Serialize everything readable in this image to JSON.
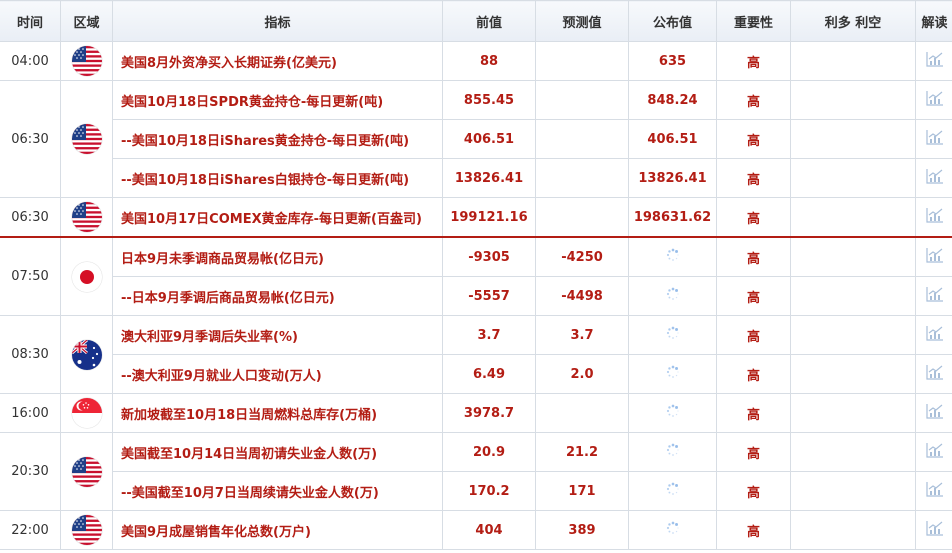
{
  "header": {
    "time": "时间",
    "region": "区域",
    "indicator": "指标",
    "previous": "前值",
    "forecast": "预测值",
    "actual": "公布值",
    "importance": "重要性",
    "impact": "利多 利空",
    "analysis": "解读"
  },
  "groups": [
    {
      "time": "04:00",
      "flag": "us-flag-icon"
    },
    {
      "time": "06:30",
      "flag": "us-flag-icon"
    },
    {
      "time": "06:30",
      "flag": "us-flag-icon"
    },
    {
      "time": "07:50",
      "flag": "japan-flag-icon"
    },
    {
      "time": "08:30",
      "flag": "australia-flag-icon"
    },
    {
      "time": "16:00",
      "flag": "singapore-flag-icon"
    },
    {
      "time": "20:30",
      "flag": "us-flag-icon"
    },
    {
      "time": "22:00",
      "flag": "us-flag-icon"
    }
  ],
  "rows": [
    {
      "indicator": "美国8月外资净买入长期证券(亿美元)",
      "previous": "88",
      "forecast": "",
      "actual": "635",
      "importance": "高"
    },
    {
      "indicator": "美国10月18日SPDR黄金持仓-每日更新(吨)",
      "previous": "855.45",
      "forecast": "",
      "actual": "848.24",
      "importance": "高"
    },
    {
      "indicator": "--美国10月18日iShares黄金持仓-每日更新(吨)",
      "previous": "406.51",
      "forecast": "",
      "actual": "406.51",
      "importance": "高"
    },
    {
      "indicator": "--美国10月18日iShares白银持仓-每日更新(吨)",
      "previous": "13826.41",
      "forecast": "",
      "actual": "13826.41",
      "importance": "高"
    },
    {
      "indicator": "美国10月17日COMEX黄金库存-每日更新(百盎司)",
      "previous": "199121.16",
      "forecast": "",
      "actual": "198631.62",
      "importance": "高"
    },
    {
      "indicator": "日本9月未季调商品贸易帐(亿日元)",
      "previous": "-9305",
      "forecast": "-4250",
      "actual": "",
      "importance": "高"
    },
    {
      "indicator": "--日本9月季调后商品贸易帐(亿日元)",
      "previous": "-5557",
      "forecast": "-4498",
      "actual": "",
      "importance": "高"
    },
    {
      "indicator": "澳大利亚9月季调后失业率(%)",
      "previous": "3.7",
      "forecast": "3.7",
      "actual": "",
      "importance": "高"
    },
    {
      "indicator": "--澳大利亚9月就业人口变动(万人)",
      "previous": "6.49",
      "forecast": "2.0",
      "actual": "",
      "importance": "高"
    },
    {
      "indicator": "新加坡截至10月18日当周燃料总库存(万桶)",
      "previous": "3978.7",
      "forecast": "",
      "actual": "",
      "importance": "高"
    },
    {
      "indicator": "美国截至10月14日当周初请失业金人数(万)",
      "previous": "20.9",
      "forecast": "21.2",
      "actual": "",
      "importance": "高"
    },
    {
      "indicator": "--美国截至10月7日当周续请失业金人数(万)",
      "previous": "170.2",
      "forecast": "171",
      "actual": "",
      "importance": "高"
    },
    {
      "indicator": "美国9月成屋销售年化总数(万户)",
      "previous": "404",
      "forecast": "389",
      "actual": "",
      "importance": "高"
    }
  ],
  "colors": {
    "accent": "#b31d14",
    "border": "#d7dde4",
    "spinner": "#8fb8e8",
    "chart_icon": "#a9bfd9"
  }
}
